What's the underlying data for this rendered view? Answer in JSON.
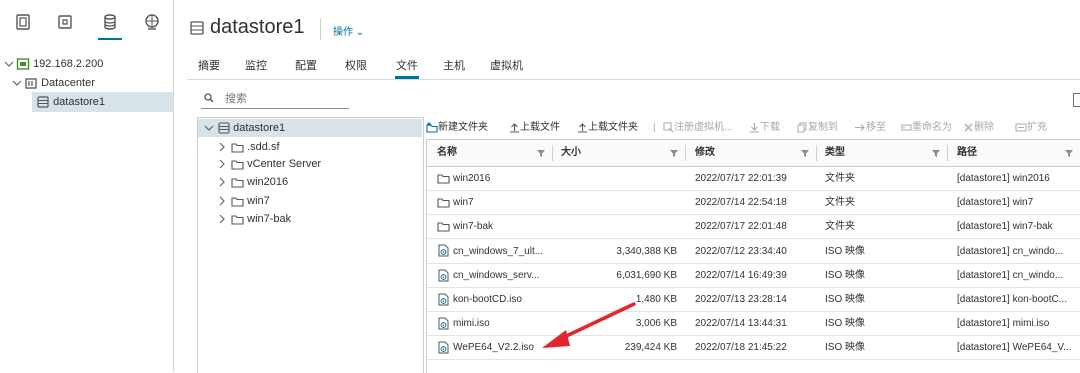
{
  "nav": {
    "tabs": [
      {
        "icon": "hosts-clusters-icon",
        "active": false
      },
      {
        "icon": "vms-templates-icon",
        "active": false
      },
      {
        "icon": "storage-icon",
        "active": true
      },
      {
        "icon": "networking-icon",
        "active": false
      }
    ],
    "tree": {
      "host": "192.168.2.200",
      "datacenter": "Datacenter",
      "datastore": "datastore1"
    }
  },
  "header": {
    "title": "datastore1",
    "actions_label": "操作 ⌄"
  },
  "tabs": [
    "摘要",
    "监控",
    "配置",
    "权限",
    "文件",
    "主机",
    "虚拟机"
  ],
  "active_tab": "文件",
  "search": {
    "placeholder": "搜索"
  },
  "file_tree": {
    "root": "datastore1",
    "children": [
      ".sdd.sf",
      "vCenter Server",
      "win2016",
      "win7",
      "win7-bak"
    ]
  },
  "toolbar": {
    "new_folder": "新建文件夹",
    "upload_file": "上载文件",
    "upload_folder": "上载文件夹",
    "register_vm": "注册虚拟机...",
    "download": "下载",
    "copy_to": "复制到",
    "move_to": "移至",
    "rename": "重命名为",
    "delete": "删除",
    "expand": "扩充"
  },
  "grid": {
    "columns": [
      "名称",
      "大小",
      "修改",
      "类型",
      "路径"
    ],
    "rows": [
      {
        "icon": "folder-icon",
        "name": "win2016",
        "size": "",
        "modified": "2022/07/17 22:01:39",
        "type": "文件夹",
        "path": "[datastore1] win2016"
      },
      {
        "icon": "folder-icon",
        "name": "win7",
        "size": "",
        "modified": "2022/07/14 22:54:18",
        "type": "文件夹",
        "path": "[datastore1] win7"
      },
      {
        "icon": "folder-icon",
        "name": "win7-bak",
        "size": "",
        "modified": "2022/07/17 22:01:48",
        "type": "文件夹",
        "path": "[datastore1] win7-bak"
      },
      {
        "icon": "iso-file-icon",
        "name": "cn_windows_7_ult...",
        "size": "3,340,388 KB",
        "modified": "2022/07/12 23:34:40",
        "type": "ISO 映像",
        "path": "[datastore1] cn_windo..."
      },
      {
        "icon": "iso-file-icon",
        "name": "cn_windows_serv...",
        "size": "6,031,690 KB",
        "modified": "2022/07/14 16:49:39",
        "type": "ISO 映像",
        "path": "[datastore1] cn_windo..."
      },
      {
        "icon": "iso-file-icon",
        "name": "kon-bootCD.iso",
        "size": "1,480 KB",
        "modified": "2022/07/13 23:28:14",
        "type": "ISO 映像",
        "path": "[datastore1] kon-bootC..."
      },
      {
        "icon": "iso-file-icon",
        "name": "mimi.iso",
        "size": "3,006 KB",
        "modified": "2022/07/14 13:44:31",
        "type": "ISO 映像",
        "path": "[datastore1] mimi.iso"
      },
      {
        "icon": "iso-file-icon",
        "name": "WePE64_V2.2.iso",
        "size": "239,424 KB",
        "modified": "2022/07/18 21:45:22",
        "type": "ISO 映像",
        "path": "[datastore1] WePE64_V..."
      }
    ]
  },
  "colors": {
    "accent": "#0072a3",
    "selected_bg": "#d8e3e9",
    "annotation_arrow": "#e3262b"
  }
}
